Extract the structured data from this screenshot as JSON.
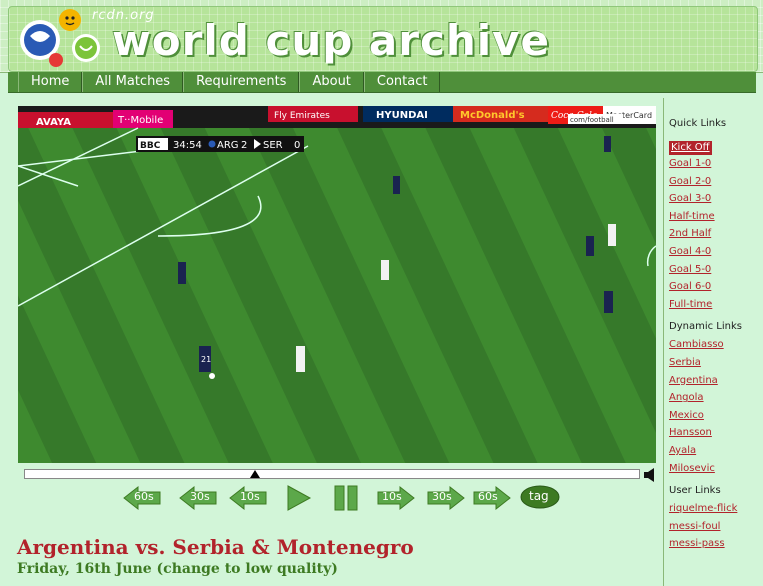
{
  "site": {
    "domain": "rcdn.org",
    "title": "world cup archive"
  },
  "nav": [
    "Home",
    "All Matches",
    "Requirements",
    "About",
    "Contact"
  ],
  "video": {
    "scoreboard": {
      "broadcaster": "BBC",
      "clock": "34:54",
      "team1": "ARG",
      "score1": "2",
      "team2": "SER",
      "score2": "0"
    },
    "boards": [
      "AVAYA",
      "T··Mobile",
      "Fly Emirates",
      "HYUNDAI",
      "McDonald's",
      "Coca-Cola",
      "com/football",
      "MasterCard"
    ],
    "player_number": "21",
    "seek_progress": 0.38
  },
  "controls": [
    "60s",
    "30s",
    "10s",
    "play",
    "pause",
    "10s",
    "30s",
    "60s",
    "tag"
  ],
  "match": {
    "title": "Argentina vs. Serbia & Montenegro",
    "date": "Friday, 16th June (change to low quality)"
  },
  "sidebar": {
    "quick_heading": "Quick Links",
    "quick": [
      "Kick Off",
      "Goal 1-0",
      "Goal 2-0",
      "Goal 3-0",
      "Half-time",
      "2nd Half",
      "Goal 4-0",
      "Goal 5-0",
      "Goal 6-0",
      "Full-time"
    ],
    "dynamic_heading": "Dynamic Links",
    "dynamic": [
      "Cambiasso",
      "Serbia",
      "Argentina",
      "Angola",
      "Mexico",
      "Hansson",
      "Ayala",
      "Milosevic"
    ],
    "user_heading": "User Links",
    "user": [
      "riquelme-flick",
      "messi-foul",
      "messi-pass"
    ]
  },
  "colors": {
    "accent_red": "#b2232b",
    "nav_green": "#4f8f3a",
    "page_bg": "#d2f5d8",
    "date_green": "#3d7a22"
  }
}
